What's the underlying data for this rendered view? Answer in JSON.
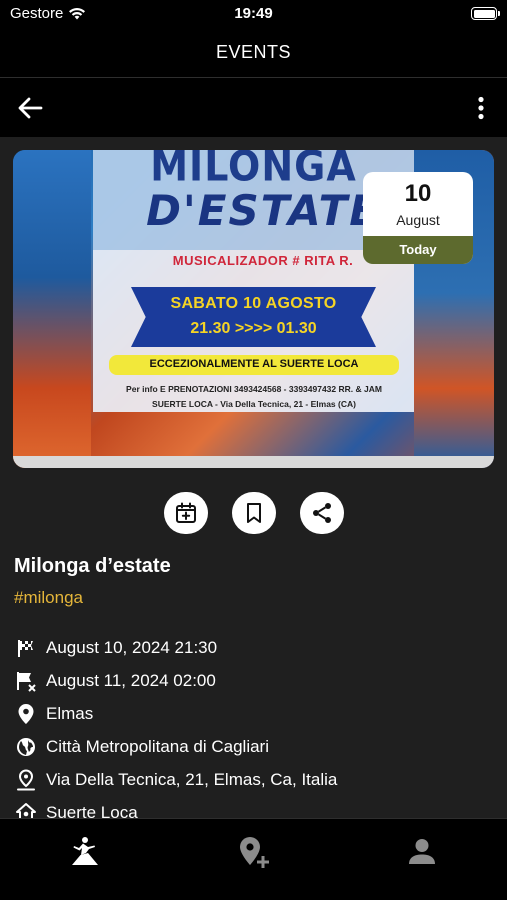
{
  "status_bar": {
    "carrier": "Gestore",
    "time": "19:49",
    "battery_level": 1.0,
    "icons": [
      "wifi-icon",
      "battery-icon"
    ]
  },
  "header": {
    "title": "EVENTS"
  },
  "toolbar": {
    "icons": [
      "arrow-left-icon",
      "more-vertical-icon"
    ]
  },
  "poster": {
    "title_line1": "MILONGA",
    "title_line2": "D'ESTATE",
    "music_line": "MUSICALIZADOR # RITA R.",
    "date_line": "SABATO 10 AGOSTO",
    "hours_line": "21.30 >>>> 01.30",
    "special_line": "ECCEZIONALMENTE AL SUERTE LOCA",
    "info_line1": "Per info E PRENOTAZIONI 3493424568 - 3393497432 RR. & JAM",
    "info_line2": "SUERTE LOCA - Via Della Tecnica, 21 - Elmas (CA)"
  },
  "date_badge": {
    "day": "10",
    "month": "August",
    "label": "Today",
    "label_color": "#5d6a2e"
  },
  "actions": {
    "icons": [
      "calendar-add-icon",
      "bookmark-icon",
      "share-icon"
    ]
  },
  "event": {
    "title": "Milonga d’estate",
    "tag": "#milonga",
    "tag_color": "#e5b63a"
  },
  "details": {
    "start": "August 10, 2024 21:30",
    "end": "August 11, 2024 02:00",
    "city": "Elmas",
    "region": "Città Metropolitana di Cagliari",
    "address": "Via Della Tecnica, 21, Elmas, Ca, Italia",
    "venue": "Suerte Loca",
    "icons": [
      "flag-checkered-icon",
      "flag-remove-icon",
      "map-marker-icon",
      "globe-icon",
      "map-marker-outline-icon",
      "home-marker-icon"
    ]
  },
  "bottom_nav": {
    "icons": [
      "dance-icon",
      "map-marker-plus-icon",
      "account-icon"
    ]
  }
}
